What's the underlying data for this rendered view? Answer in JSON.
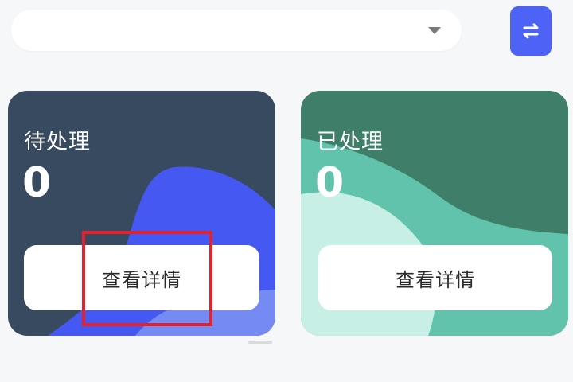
{
  "filter": {
    "selected_value": ""
  },
  "cards": [
    {
      "title": "待处理",
      "count": "0",
      "button_label": "查看详情",
      "background": "#384a5f",
      "accent": "#4559f2"
    },
    {
      "title": "已处理",
      "count": "0",
      "button_label": "查看详情",
      "background": "#3f7f69",
      "accent": "#61c3ab"
    }
  ],
  "colors": {
    "swap_button": "#4c63f6",
    "highlight": "#e2232f"
  },
  "icons": {
    "dropdown": "chevron-down-icon",
    "swap": "swap-arrows-icon"
  }
}
